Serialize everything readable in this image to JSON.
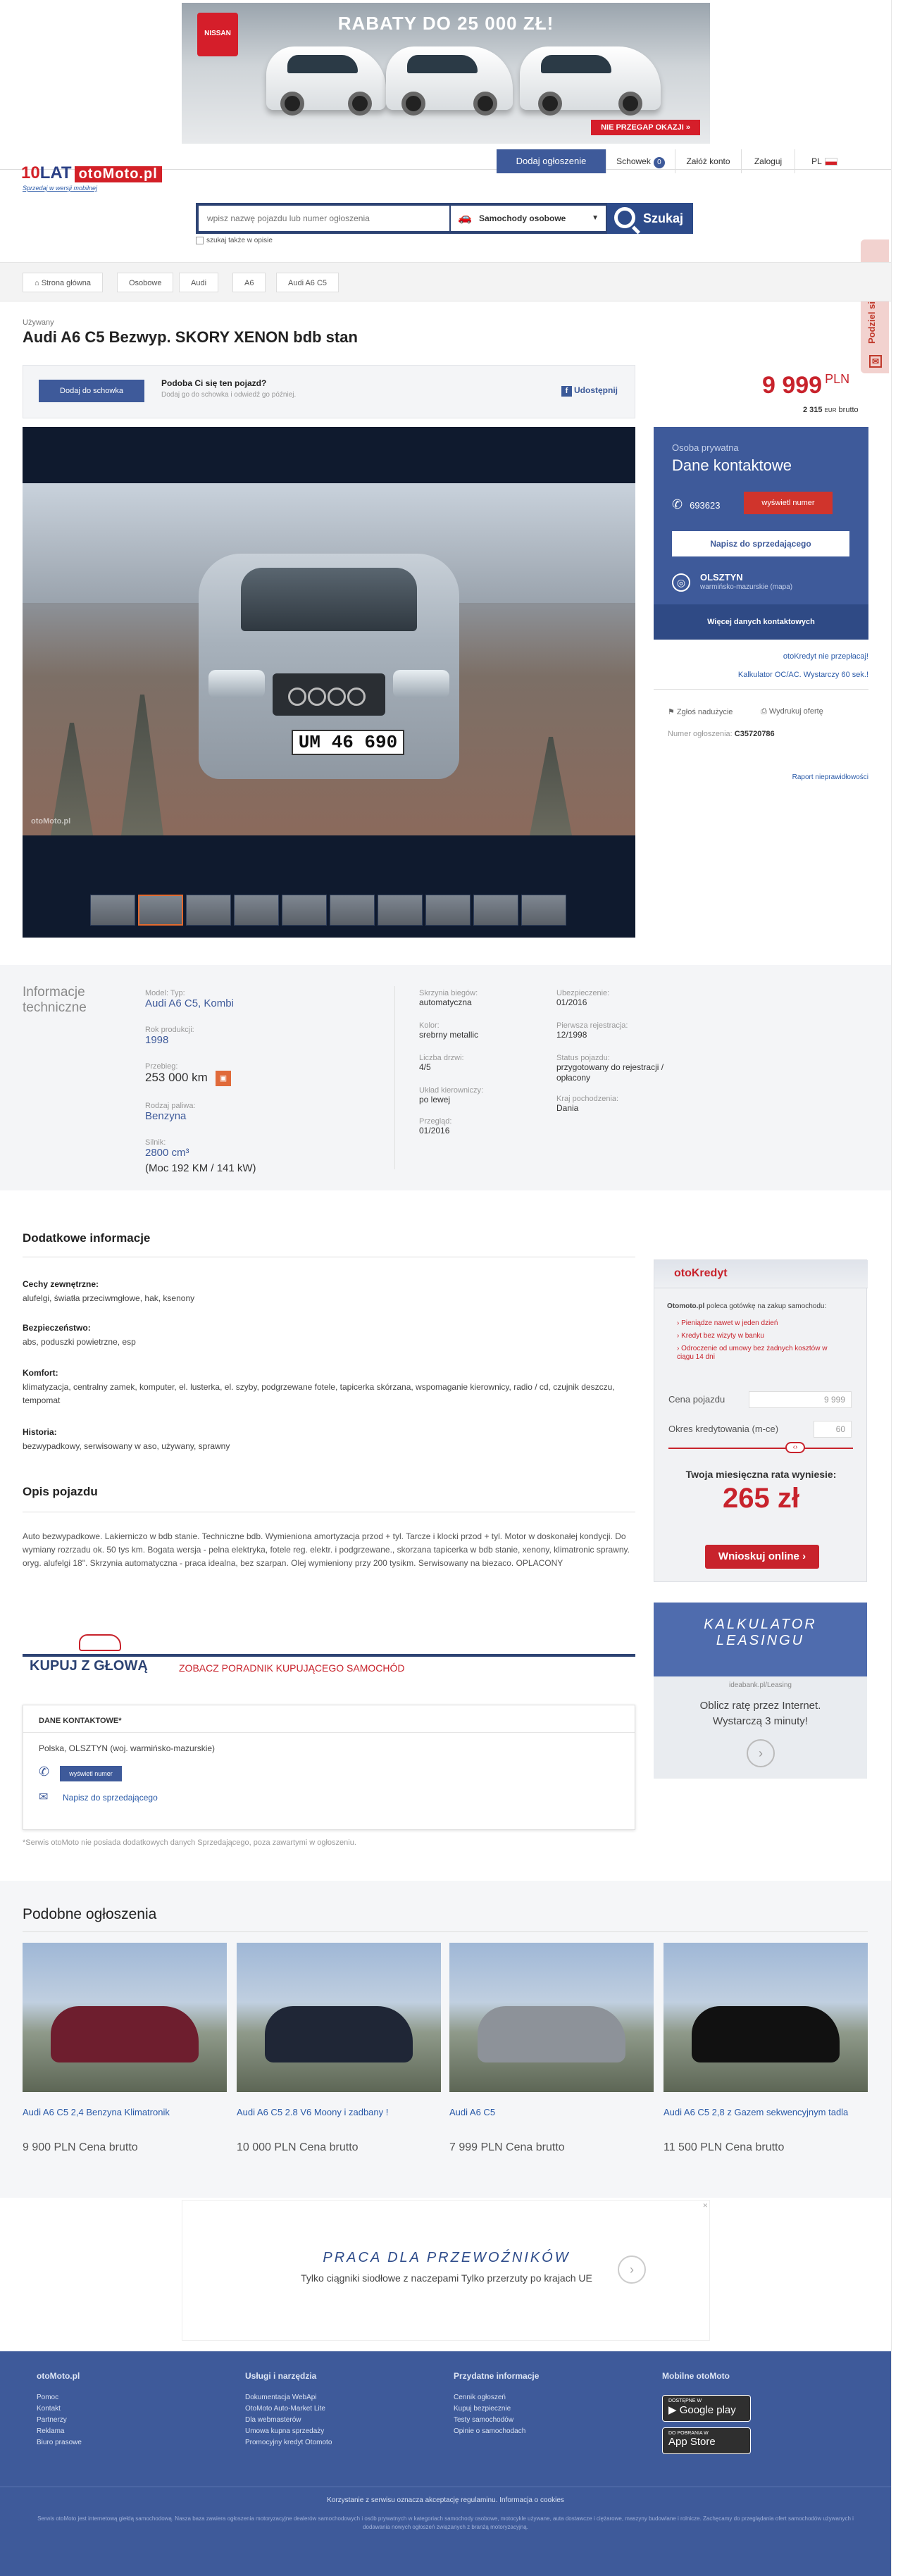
{
  "ad_banner": {
    "brand": "NISSAN",
    "headline": "RABATY DO 25 000 ZŁ!",
    "cta": "NIE PRZEGAP OKAZJI »"
  },
  "header": {
    "logo_number": "10",
    "logo_text": "LAT",
    "logo_site": "otoMoto.pl",
    "tagline": "Sprzedaj w wersji mobilnej",
    "nav": {
      "add_listing": "Dodaj ogłoszenie",
      "clipboard": "Schowek",
      "clipboard_count": "0",
      "register": "Załóż konto",
      "login": "Zaloguj",
      "lang": "PL"
    },
    "search": {
      "placeholder": "wpisz nazwę pojazdu lub numer ogłoszenia",
      "category": "Samochody osobowe",
      "button": "Szukaj",
      "checkbox_label": "szukaj także w opisie"
    },
    "side_tab": "Podziel się opinią"
  },
  "breadcrumb": [
    "Strona główna",
    "Osobowe",
    "Audi",
    "A6",
    "Audi A6 C5"
  ],
  "listing": {
    "condition": "Używany",
    "title": "Audi A6 C5 Bezwyp. SKORY XENON bdb stan",
    "price": "9 999",
    "currency": "PLN",
    "price_sub": "2 315",
    "price_sub_currency": "EUR",
    "price_sub_label": "brutto",
    "clipboard_button": "Dodaj do schowka",
    "clipboard_question": "Podoba Ci się ten pojazd?",
    "clipboard_sub": "Dodaj go do schowka i odwiedź go później.",
    "share": "Udostępnij",
    "plate": "UM 46 690",
    "watermark": "otoMoto.pl"
  },
  "contact": {
    "type": "Osoba prywatna",
    "heading": "Dane kontaktowe",
    "phone_prefix": "693623",
    "show_number": "wyświetl numer",
    "write": "Napisz do sprzedającego",
    "city": "OLSZTYN",
    "region": "warmińsko-mazurskie (mapa)",
    "more": "Więcej danych kontaktowych",
    "credit_link": "otoKredyt nie przepłacaj!",
    "oc_link": "Kalkulator OC/AC. Wystarczy 60 sek.!",
    "report": "Zgłoś nadużycie",
    "print": "Wydrukuj ofertę",
    "ad_no_label": "Numer ogłoszenia:",
    "ad_no": "C35720786",
    "report_bug": "Raport nieprawidłowości"
  },
  "tech": {
    "heading_1": "Informacje",
    "heading_2": "techniczne",
    "col1": [
      {
        "label": "Model: Typ:",
        "value": "Audi A6 C5, Kombi"
      },
      {
        "label": "Rok produkcji:",
        "value": "1998"
      },
      {
        "label": "Przebieg:",
        "value": "253 000 km"
      },
      {
        "label": "Rodzaj paliwa:",
        "value": "Benzyna"
      },
      {
        "label": "Silnik:",
        "value": "2800 cm³",
        "extra": "(Moc 192 KM / 141 kW)"
      }
    ],
    "col2": [
      {
        "label": "Skrzynia biegów:",
        "value": "automatyczna"
      },
      {
        "label": "Kolor:",
        "value": "srebrny metallic"
      },
      {
        "label": "Liczba drzwi:",
        "value": "4/5"
      },
      {
        "label": "Układ kierowniczy:",
        "value": "po lewej"
      },
      {
        "label": "Przegląd:",
        "value": "01/2016"
      }
    ],
    "col3": [
      {
        "label": "Ubezpieczenie:",
        "value": "01/2016"
      },
      {
        "label": "Pierwsza rejestracja:",
        "value": "12/1998"
      },
      {
        "label": "Status pojazdu:",
        "value": "przygotowany do rejestracji / opłacony"
      },
      {
        "label": "Kraj pochodzenia:",
        "value": "Dania"
      }
    ]
  },
  "extra": {
    "heading": "Dodatkowe informacje",
    "groups": [
      {
        "title": "Cechy zewnętrzne:",
        "text": "alufelgi, światła przeciwmgłowe, hak, ksenony"
      },
      {
        "title": "Bezpieczeństwo:",
        "text": "abs, poduszki powietrzne, esp"
      },
      {
        "title": "Komfort:",
        "text": "klimatyzacja, centralny zamek, komputer, el. lusterka, el. szyby, podgrzewane fotele, tapicerka skórzana, wspomaganie kierownicy, radio / cd, czujnik deszczu, tempomat"
      },
      {
        "title": "Historia:",
        "text": "bezwypadkowy, serwisowany w aso, używany, sprawny"
      }
    ],
    "desc_heading": "Opis pojazdu",
    "description": "Auto bezwypadkowe. Lakierniczo w bdb stanie. Techniczne bdb. Wymieniona amortyzacja przod + tyl. Tarcze i klocki przod + tyl. Motor w doskonałej kondycji. Do wymiany rozrzadu ok. 50 tys km. Bogata wersja - pelna elektryka, fotele reg. elektr. i podgrzewane., skorzana tapicerka w bdb stanie, xenony, klimatronic sprawny. oryg. alufelgi 18\". Skrzynia automatyczna - praca idealna, bez szarpan. Olej wymieniony przy 200 tysikm. Serwisowany na biezaco. OPLACONY"
  },
  "guide": {
    "left": "KUPUJ Z GŁOWĄ",
    "right": "ZOBACZ PORADNIK KUPUJĄCEGO SAMOCHÓD"
  },
  "dane": {
    "heading": "DANE KONTAKTOWE*",
    "location": "Polska, OLSZTYN (woj. warmińsko-mazurskie)",
    "show_number": "wyświetl numer",
    "write": "Napisz do sprzedającego",
    "note": "*Serwis otoMoto nie posiada dodatkowych danych Sprzedającego, poza zawartymi w ogłoszeniu."
  },
  "kredyt": {
    "brand": "otoKredyt",
    "intro_brand": "Otomoto.pl",
    "intro": " poleca gotówkę na zakup samochodu:",
    "bullets": [
      "Pieniądze nawet w jeden dzień",
      "Kredyt bez wizyty w banku",
      "Odroczenie od umowy bez żadnych kosztów w ciągu 14 dni"
    ],
    "price_label": "Cena pojazdu",
    "price_value": "9 999",
    "period_label": "Okres kredytowania (m-ce)",
    "period_value": "60",
    "rate_label": "Twoja miesięczna rata wyniesie:",
    "rate_value": "265 zł",
    "button": "Wnioskuj online ›"
  },
  "leasing_ad": {
    "title_1": "KALKULATOR",
    "title_2": "LEASINGU",
    "domain": "ideabank.pl/Leasing",
    "text_1": "Oblicz ratę przez Internet.",
    "text_2": "Wystarczą 3 minuty!"
  },
  "similar": {
    "heading": "Podobne ogłoszenia",
    "items": [
      {
        "title": "Audi A6 C5 2,4 Benzyna Klimatronik",
        "price": "9 900 PLN Cena brutto",
        "color": "#6e1e2e"
      },
      {
        "title": "Audi A6 C5 2.8 V6 Moony i zadbany !",
        "price": "10 000 PLN Cena brutto",
        "color": "#1f2636"
      },
      {
        "title": "Audi A6 C5",
        "price": "7 999 PLN Cena brutto",
        "color": "#8d9299"
      },
      {
        "title": "Audi A6 C5 2,8 z Gazem sekwencyjnym tadla",
        "price": "11 500 PLN Cena brutto",
        "color": "#111111"
      }
    ]
  },
  "ad_bottom": {
    "title": "PRACA DLA PRZEWOŹNIKÓW",
    "text": "Tylko ciągniki siodłowe z naczepami Tylko przerzuty po krajach UE"
  },
  "footer": {
    "col1_head": "otoMoto.pl",
    "col1": [
      "Pomoc",
      "Kontakt",
      "Partnerzy",
      "Reklama",
      "Biuro prasowe"
    ],
    "col2_head": "Usługi i narzędzia",
    "col2": [
      "Dokumentacja WebApi",
      "OtoMoto Auto-Market Lite",
      "Dla webmasterów",
      "Umowa kupna sprzedaży",
      "Promocyjny kredyt Otomoto"
    ],
    "col3_head": "Przydatne informacje",
    "col3": [
      "Cennik ogłoszeń",
      "Kupuj bezpiecznie",
      "Testy samochodów",
      "Opinie o samochodach"
    ],
    "col4_head": "Mobilne otoMoto",
    "google_small": "DOSTĘPNE W",
    "google": "Google play",
    "apple_small": "DO POBRANIA W",
    "apple": "App Store",
    "copy": "Korzystanie z serwisu oznacza akceptację regulaminu. Informacja o cookies",
    "legal": "Serwis otoMoto jest internetową giełdą samochodową. Nasza baza zawiera ogłoszenia motoryzacyjne dealerów samochodowych i osób prywatnych w kategoriach samochody osobowe, motocykle używane, auta dostawcze i ciężarowe, maszyny budowlane i rolnicze. Zachęcamy do przeglądania ofert samochodów używanych i dodawania nowych ogłoszeń związanych z branżą motoryzacyjną."
  }
}
